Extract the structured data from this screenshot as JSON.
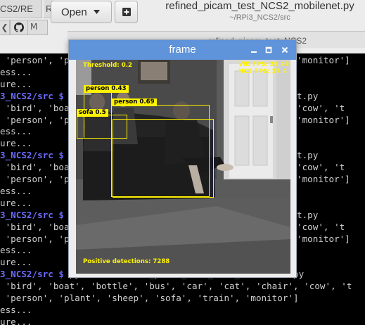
{
  "editor": {
    "tabs": [
      "CS2/RE",
      "RE"
    ],
    "nav_m_label": "M",
    "open_label": "Open",
    "title": "refined_picam_test_NCS2_mobilenet.py",
    "subtitle": "~/RPi3_NCS2/src",
    "secondary_tab_text": "refined_picam_test_NCS2"
  },
  "terminal": {
    "lines": [
      {
        "text": " 'person', 'p",
        "tail": "'monitor']"
      },
      {
        "text": "ess...",
        "tail": ""
      },
      {
        "text": "ure...",
        "tail": ""
      },
      {
        "prompt": "3_NCS2/src $",
        "text": "",
        "tail": "t.py"
      },
      {
        "text": " 'bird', 'boa",
        "tail": "'cow', 't"
      },
      {
        "text": " 'person', 'p",
        "tail": "'monitor']"
      },
      {
        "text": "ess...",
        "tail": ""
      },
      {
        "text": "ure...",
        "tail": ""
      },
      {
        "prompt": "3_NCS2/src $",
        "text": "",
        "tail": "t.py"
      },
      {
        "text": " 'bird', 'boa",
        "tail": "'cow', 't"
      },
      {
        "text": " 'person', 'p",
        "tail": "'monitor']"
      },
      {
        "text": "ess...",
        "tail": ""
      },
      {
        "text": "ure...",
        "tail": ""
      },
      {
        "prompt": "3_NCS2/src $",
        "text": "",
        "tail": "t.py"
      },
      {
        "text": " 'bird', 'boa",
        "tail": "'cow', 't"
      },
      {
        "text": " 'person', 'p",
        "tail": "'monitor']"
      },
      {
        "text": "ess...",
        "tail": ""
      },
      {
        "text": "ure...",
        "tail": ""
      },
      {
        "prompt": "3_NCS2/src $",
        "text": " python3 refined_picam_test_NCS2_mobilenet.py",
        "tail": ""
      },
      {
        "text": " 'bird', 'boat', 'bottle', 'bus', 'car', 'cat', 'chair', 'cow', 't",
        "tail": ""
      },
      {
        "text": " 'person', 'plant', 'sheep', 'sofa', 'train', 'monitor']",
        "tail": ""
      },
      {
        "text": "ess...",
        "tail": ""
      },
      {
        "text": "ure...",
        "tail": ""
      }
    ]
  },
  "frame_window": {
    "title": "frame",
    "overlay": {
      "threshold": "Threshold: 0.2",
      "vid_fps": "VID FPS: 29.49",
      "ncs_fps": "NCS FPS: 27.4",
      "positive": "Positive detections: 7288"
    },
    "detections": [
      {
        "label": "person 0.43"
      },
      {
        "label": "person 0.69"
      },
      {
        "label": "sofa 0.5"
      }
    ]
  },
  "colors": {
    "titlebar": "#5f93da",
    "overlay": "#fff200",
    "prompt": "#6c6cff"
  }
}
